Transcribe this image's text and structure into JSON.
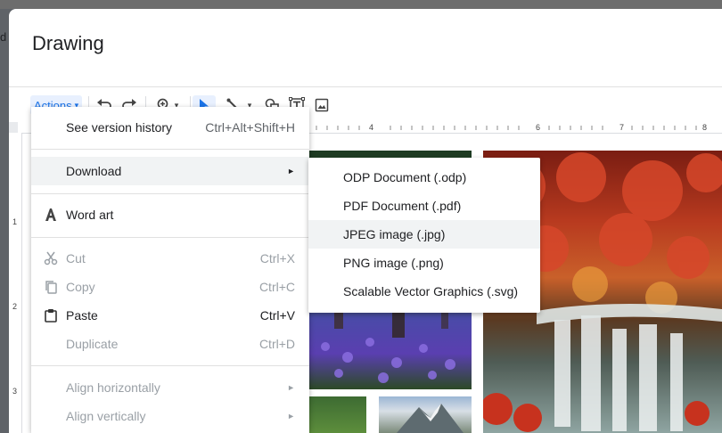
{
  "dialog": {
    "title": "Drawing"
  },
  "background_hint": "d",
  "toolbar": {
    "actions_label": "Actions",
    "actions_caret": "▾",
    "zoom_caret": "▾",
    "line_caret": "▾"
  },
  "ruler": {
    "top_labels": [
      "4",
      "6",
      "7",
      "8"
    ],
    "left_labels": [
      "1",
      "2",
      "3"
    ]
  },
  "actions_menu": {
    "items": [
      {
        "label": "See version history",
        "shortcut": "Ctrl+Alt+Shift+H"
      },
      {
        "label": "Download",
        "submenu_arrow": "►"
      },
      {
        "label": "Word art"
      },
      {
        "label": "Cut",
        "shortcut": "Ctrl+X"
      },
      {
        "label": "Copy",
        "shortcut": "Ctrl+C"
      },
      {
        "label": "Paste",
        "shortcut": "Ctrl+V"
      },
      {
        "label": "Duplicate",
        "shortcut": "Ctrl+D"
      },
      {
        "label": "Align horizontally",
        "submenu_arrow": "►"
      },
      {
        "label": "Align vertically",
        "submenu_arrow": "►"
      }
    ]
  },
  "download_submenu": {
    "items": [
      {
        "label": "ODP Document (.odp)"
      },
      {
        "label": "PDF Document (.pdf)"
      },
      {
        "label": "JPEG image (.jpg)"
      },
      {
        "label": "PNG image (.png)"
      },
      {
        "label": "Scalable Vector Graphics (.svg)"
      }
    ]
  },
  "colors": {
    "accent": "#1a73e8",
    "highlight": "#f1f3f4",
    "disabled": "#9aa0a6"
  },
  "icons": [
    "undo-icon",
    "redo-icon",
    "zoom-icon",
    "select-cursor-icon",
    "line-icon",
    "shape-icon",
    "text-box-icon",
    "image-icon",
    "word-art-icon",
    "cut-icon",
    "copy-icon",
    "paste-icon"
  ]
}
